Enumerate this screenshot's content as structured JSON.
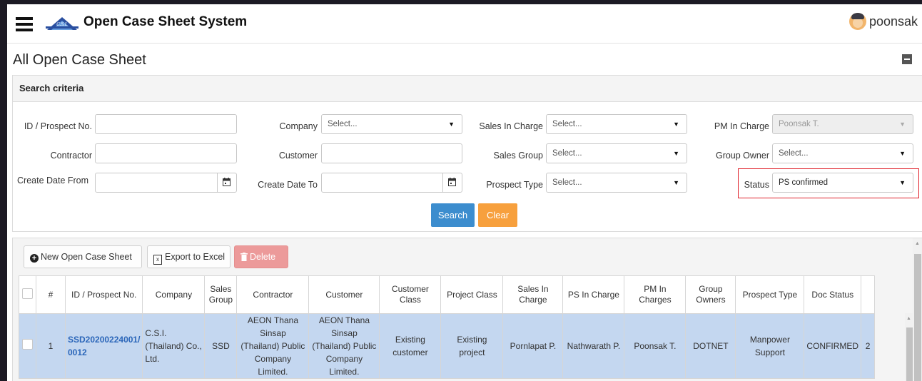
{
  "app": {
    "title": "Open Case Sheet System",
    "logo_text": "C.S.I.",
    "user_name": "poonsak"
  },
  "page": {
    "title": "All Open Case Sheet"
  },
  "search": {
    "header": "Search criteria",
    "fields": {
      "id_prospect": {
        "label": "ID / Prospect No.",
        "value": ""
      },
      "company": {
        "label": "Company",
        "value": "Select..."
      },
      "sales_in_charge": {
        "label": "Sales In Charge",
        "value": "Select..."
      },
      "pm_in_charge": {
        "label": "PM In Charge",
        "value": "Poonsak T."
      },
      "contractor": {
        "label": "Contractor",
        "value": ""
      },
      "customer": {
        "label": "Customer",
        "value": ""
      },
      "sales_group": {
        "label": "Sales Group",
        "value": "Select..."
      },
      "group_owner": {
        "label": "Group Owner",
        "value": "Select..."
      },
      "create_date_from": {
        "label": "Create Date From",
        "value": ""
      },
      "create_date_to": {
        "label": "Create Date To",
        "value": ""
      },
      "prospect_type": {
        "label": "Prospect Type",
        "value": "Select..."
      },
      "status": {
        "label": "Status",
        "value": "PS confirmed"
      }
    },
    "buttons": {
      "search": "Search",
      "clear": "Clear"
    }
  },
  "toolbar": {
    "new_label": "New Open Case Sheet",
    "export_label": "Export to Excel",
    "delete_label": "Delete"
  },
  "table": {
    "headers": [
      "#",
      "ID / Prospect No.",
      "Company",
      "Sales Group",
      "Contractor",
      "Customer",
      "Customer Class",
      "Project Class",
      "Sales In Charge",
      "PS In Charge",
      "PM In Charges",
      "Group Owners",
      "Prospect Type",
      "Doc Status"
    ],
    "rows": [
      {
        "num": "1",
        "id": "SSD20200224001/ 0012",
        "company": "C.S.I. (Thailand) Co., Ltd.",
        "sales_group": "SSD",
        "contractor": "AEON Thana Sinsap (Thailand) Public Company Limited.",
        "customer": "AEON Thana Sinsap (Thailand) Public Company Limited.",
        "customer_class": "Existing customer",
        "project_class": "Existing project",
        "sales_in_charge": "Pornlapat P.",
        "ps_in_charge": "Nathwarath P.",
        "pm_in_charges": "Poonsak T.",
        "group_owners": "DOTNET",
        "prospect_type": "Manpower Support",
        "doc_status": "CONFIRMED",
        "extra": "2"
      }
    ]
  },
  "colors": {
    "primary": "#3c8dce",
    "warning": "#f7a03d",
    "danger": "#ec9a9a",
    "selected_row": "#c4d7f0",
    "link": "#2b66b9",
    "highlight_border": "#e0202a"
  }
}
